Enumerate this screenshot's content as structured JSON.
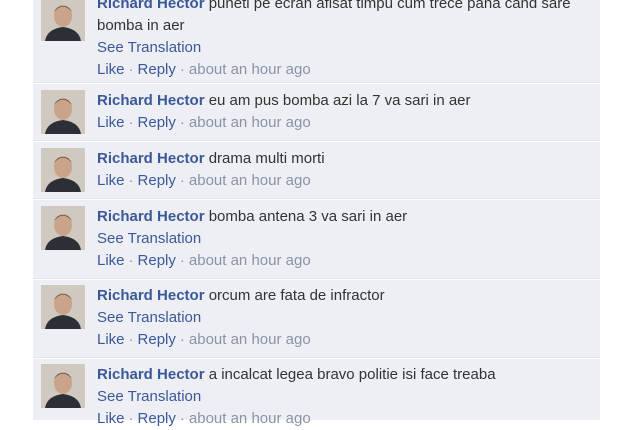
{
  "colors": {
    "link": "#3b5998",
    "comment_bg": "#edeff4",
    "meta": "#8a93a6"
  },
  "comments": [
    {
      "author": "Richard Hector",
      "text": "puneti pe ecran afisat timpu cum trece pana cand sare bomba in aer",
      "see_translation": "See Translation",
      "like": "Like",
      "reply": "Reply",
      "time": "about an hour ago"
    },
    {
      "author": "Richard Hector",
      "text": "eu am pus bomba azi la 7 va sari in aer",
      "like": "Like",
      "reply": "Reply",
      "time": "about an hour ago"
    },
    {
      "author": "Richard Hector",
      "text": "drama multi morti",
      "like": "Like",
      "reply": "Reply",
      "time": "about an hour ago"
    },
    {
      "author": "Richard Hector",
      "text": "bomba antena 3 va sari in aer",
      "see_translation": "See Translation",
      "like": "Like",
      "reply": "Reply",
      "time": "about an hour ago"
    },
    {
      "author": "Richard Hector",
      "text": "orcum are fata de infractor",
      "see_translation": "See Translation",
      "like": "Like",
      "reply": "Reply",
      "time": "about an hour ago"
    },
    {
      "author": "Richard Hector",
      "text": "a incalcat legea bravo politie isi face treaba",
      "see_translation": "See Translation",
      "like": "Like",
      "reply": "Reply",
      "time": "about an hour ago"
    }
  ]
}
